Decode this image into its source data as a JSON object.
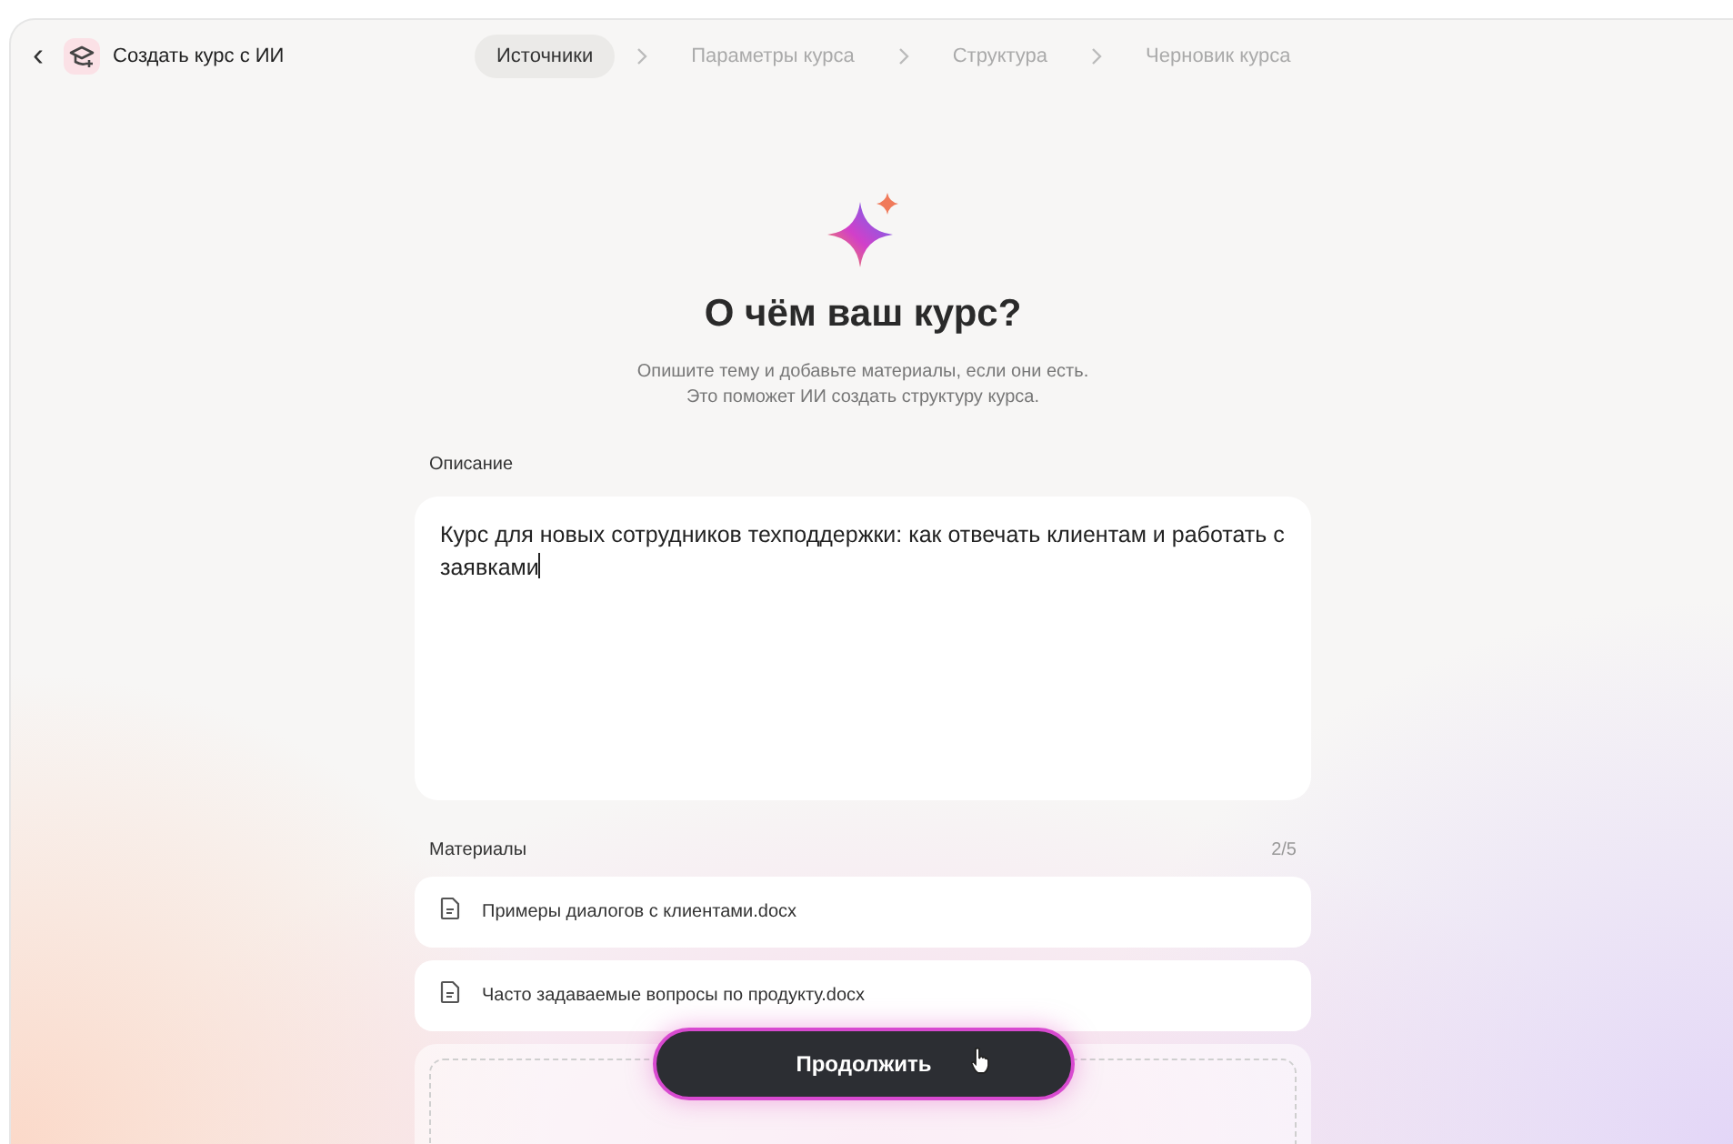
{
  "header": {
    "back": "‹",
    "title": "Создать курс с ИИ"
  },
  "steps": [
    {
      "label": "Источники",
      "selected": true
    },
    {
      "label": "Параметры курса",
      "selected": false
    },
    {
      "label": "Структура",
      "selected": false
    },
    {
      "label": "Черновик курса",
      "selected": false
    }
  ],
  "heading": "О чём ваш курс?",
  "subtitle": [
    "Опишите тему и добавьте материалы, если они есть.",
    "Это поможет ИИ создать структуру курса."
  ],
  "description": {
    "label": "Описание",
    "value": "Курс для новых сотрудников техподдержки: как отвечать клиентам и работать с заявками"
  },
  "materials": {
    "label": "Материалы",
    "count": "2/5",
    "files": [
      {
        "name": "Примеры диалогов с клиентами.docx"
      },
      {
        "name": "Часто задаваемые вопросы по продукту.docx"
      }
    ]
  },
  "continue_button": "Продолжить"
}
